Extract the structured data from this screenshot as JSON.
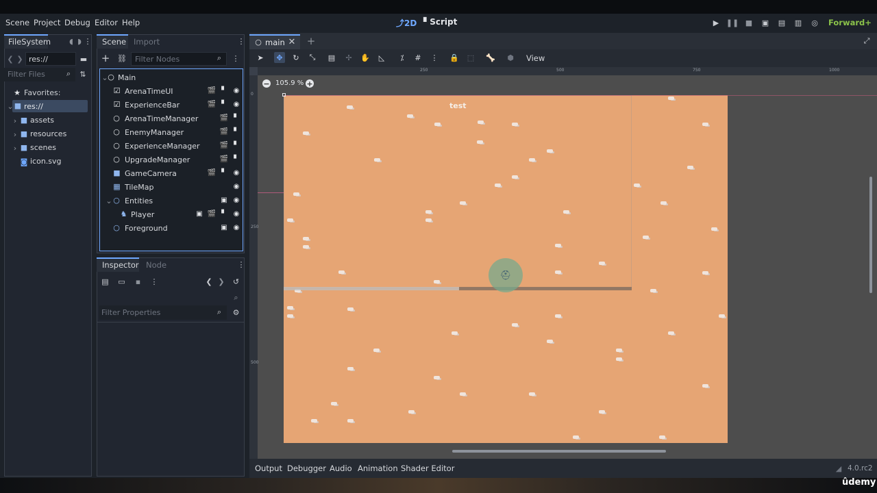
{
  "menu": [
    "Scene",
    "Project",
    "Debug",
    "Editor",
    "Help"
  ],
  "modes": {
    "two_d": "2D",
    "script": "Script"
  },
  "renderer": "Forward+",
  "filesystem": {
    "tab": "FileSystem",
    "path": "res://",
    "filter_placeholder": "Filter Files",
    "favorites": "Favorites:",
    "root": "res://",
    "items": [
      "assets",
      "resources",
      "scenes",
      "icon.svg"
    ]
  },
  "scene_dock": {
    "tabs": [
      "Scene",
      "Import"
    ],
    "filter_placeholder": "Filter Nodes",
    "nodes": [
      "Main",
      "ArenaTimeUI",
      "ExperienceBar",
      "ArenaTimeManager",
      "EnemyManager",
      "ExperienceManager",
      "UpgradeManager",
      "GameCamera",
      "TileMap",
      "Entities",
      "Player",
      "Foreground"
    ]
  },
  "inspector": {
    "tabs": [
      "Inspector",
      "Node"
    ],
    "filter_placeholder": "Filter Properties"
  },
  "viewport": {
    "tab": "main",
    "view_menu": "View",
    "zoom": "105.9 %",
    "label_text": "test",
    "ruler_marks": [
      "250",
      "500",
      "750",
      "1000"
    ],
    "ruler_left": [
      "0",
      "250",
      "500"
    ]
  },
  "bottom_tabs": [
    "Output",
    "Debugger",
    "Audio",
    "Animation",
    "Shader Editor"
  ],
  "version": "4.0.rc2",
  "watermark": "ûdemy",
  "colors": {
    "accent": "#6fa8ff",
    "ground": "#e6a574",
    "renderer": "#8bc34a",
    "panel": "#212630"
  }
}
